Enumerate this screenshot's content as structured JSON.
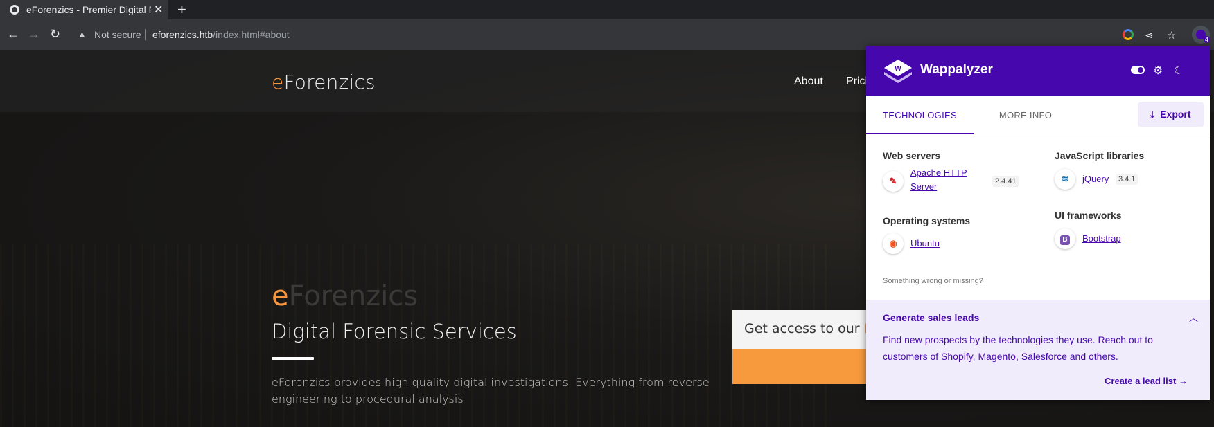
{
  "browser": {
    "tab_title": "eForenzics - Premier Digital Forensics",
    "new_tab_label": "+",
    "not_secure_label": "Not secure",
    "url_host": "eforenzics.htb",
    "url_path": "/index.html#about",
    "extension_badge": "4"
  },
  "site": {
    "brand_first": "e",
    "brand_rest": "Forenzics",
    "nav": [
      "About",
      "Pricing"
    ],
    "hero_brand_first": "e",
    "hero_brand_rest": "Forenzics",
    "hero_title": "Digital Forensic Services",
    "hero_text": "eForenzics provides high quality digital investigations. Everything from reverse engineering to procedural analysis",
    "access_card_text": "Get access to our ",
    "access_card_highlight": "FREE"
  },
  "wappalyzer": {
    "title": "Wappalyzer",
    "tabs": [
      "TECHNOLOGIES",
      "MORE INFO"
    ],
    "export_label": "Export",
    "categories": [
      {
        "name": "Web servers",
        "techs": [
          {
            "name": "Apache HTTP Server",
            "version": "2.4.41",
            "icon": "apache-feather-icon"
          }
        ]
      },
      {
        "name": "JavaScript libraries",
        "techs": [
          {
            "name": "jQuery",
            "version": "3.4.1",
            "icon": "jquery-icon"
          }
        ]
      },
      {
        "name": "Operating systems",
        "techs": [
          {
            "name": "Ubuntu",
            "icon": "ubuntu-icon"
          }
        ]
      },
      {
        "name": "UI frameworks",
        "techs": [
          {
            "name": "Bootstrap",
            "icon": "bootstrap-icon"
          }
        ]
      }
    ],
    "something_wrong": "Something wrong or missing?",
    "leads": {
      "title": "Generate sales leads",
      "text": "Find new prospects by the technologies they use. Reach out to customers of Shopify, Magento, Salesforce and others.",
      "link": "Create a lead list"
    },
    "colors": {
      "accent": "#4608ad",
      "leads_bg": "#f1ecfb"
    }
  }
}
